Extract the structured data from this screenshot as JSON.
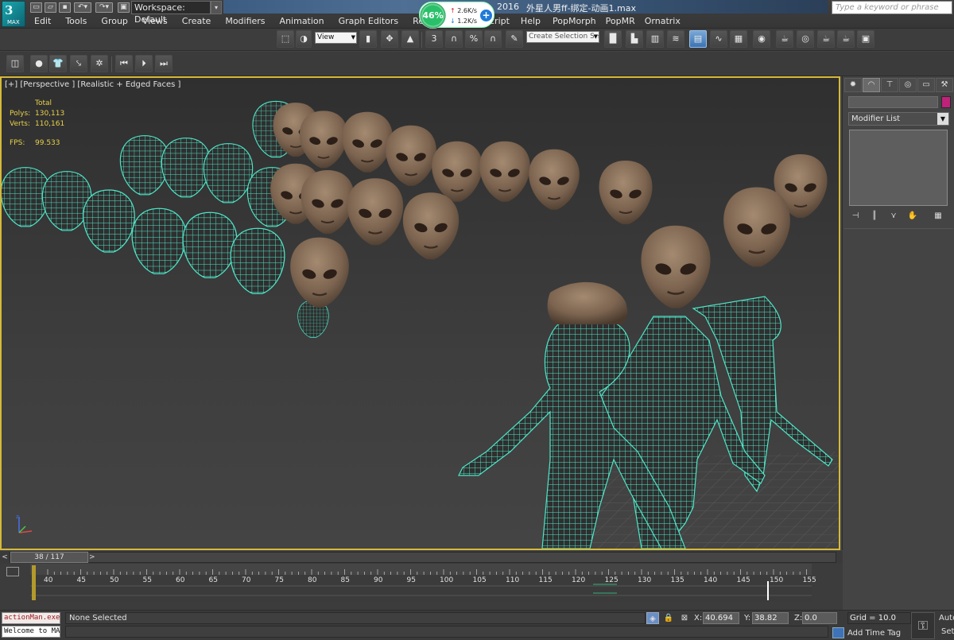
{
  "title_bar": {
    "logo_label": "MAX",
    "workspace": "Workspace: Default",
    "title_prefix": "2016",
    "window_title": "外星人男ff-绑定-动画1.max",
    "search_placeholder": "Type a keyword or phrase"
  },
  "net_monitor": {
    "percent": "46%",
    "upload": "2.6K/s",
    "download": "1.2K/s"
  },
  "menu": {
    "left": [
      "Edit",
      "Tools",
      "Group",
      "Views",
      "Create",
      "Modifiers",
      "Animation",
      "Graph Editors",
      "Rendering"
    ],
    "right": [
      "cript",
      "Help",
      "PopMorph",
      "PopMR",
      "Ornatrix"
    ]
  },
  "toolbar": {
    "ref_coord": "View",
    "selection_set_placeholder": "Create Selection Se",
    "snap_label": "3",
    "percent_snap": "%"
  },
  "viewport": {
    "label": "[+] [Perspective ] [Realistic + Edged Faces ]",
    "stats": {
      "total_label": "Total",
      "polys_label": "Polys:",
      "polys_value": "130,113",
      "verts_label": "Verts:",
      "verts_value": "110,161",
      "fps_label": "FPS:",
      "fps_value": "99.533"
    },
    "wire_color": "#4ee6c8",
    "skin_color": "#8a7058"
  },
  "command_panel": {
    "modifier_list": "Modifier List",
    "object_color": "#c0217a"
  },
  "timeline": {
    "frame_display": "38 / 117",
    "ticks": [
      "40",
      "45",
      "50",
      "55",
      "60",
      "65",
      "70",
      "75",
      "80",
      "85",
      "90",
      "95",
      "100",
      "105",
      "110",
      "115",
      "120",
      "125",
      "130",
      "135",
      "140",
      "145",
      "150",
      "155"
    ]
  },
  "status": {
    "maxscript_line1": "actionMan.execu",
    "maxscript_line2": "Welcome to MAXS",
    "selection": "None Selected",
    "x_label": "X:",
    "x_value": "40.694",
    "y_label": "Y:",
    "y_value": "38.82",
    "z_label": "Z:",
    "z_value": "0.0",
    "grid": "Grid = 10.0",
    "add_time_tag": "Add Time Tag",
    "auto": "Auto",
    "set": "Set"
  }
}
